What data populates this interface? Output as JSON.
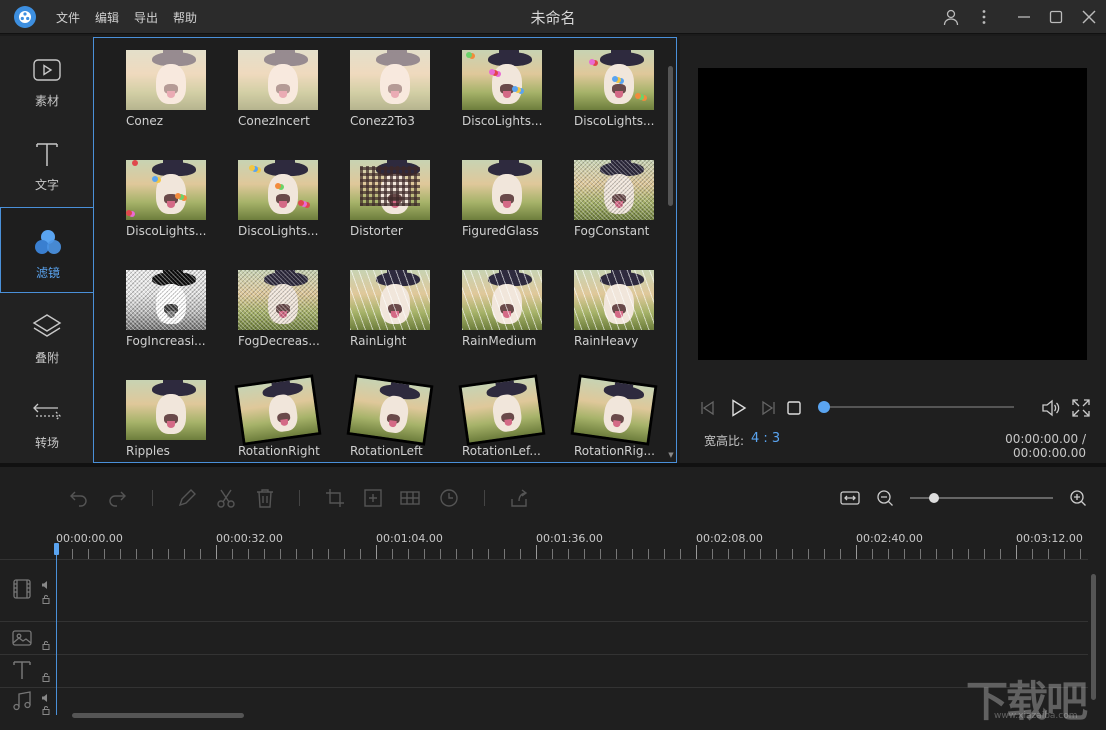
{
  "window": {
    "title": "未命名",
    "menu": [
      "文件",
      "编辑",
      "导出",
      "帮助"
    ],
    "icons": [
      "app-logo-icon",
      "user-icon",
      "more-icon",
      "minimize-icon",
      "maximize-icon",
      "close-icon"
    ]
  },
  "sidebar": {
    "items": [
      {
        "label": "素材",
        "icon": "media-icon",
        "active": false
      },
      {
        "label": "文字",
        "icon": "text-icon",
        "active": false
      },
      {
        "label": "滤镜",
        "icon": "filter-icon",
        "active": true
      },
      {
        "label": "叠附",
        "icon": "overlay-icon",
        "active": false
      },
      {
        "label": "转场",
        "icon": "transition-icon",
        "active": false
      }
    ]
  },
  "filters": [
    {
      "name": "Conez",
      "style": "faded"
    },
    {
      "name": "ConezIncert",
      "style": "faded"
    },
    {
      "name": "Conez2To3",
      "style": "faded"
    },
    {
      "name": "DiscoLights...",
      "style": "disco"
    },
    {
      "name": "DiscoLights...",
      "style": "disco"
    },
    {
      "name": "DiscoLights...",
      "style": "disco"
    },
    {
      "name": "DiscoLights...",
      "style": "disco"
    },
    {
      "name": "Distorter",
      "style": "pixel"
    },
    {
      "name": "FiguredGlass",
      "style": "plain"
    },
    {
      "name": "FogConstant",
      "style": "noise"
    },
    {
      "name": "FogIncreasi...",
      "style": "gray"
    },
    {
      "name": "FogDecreas...",
      "style": "noise"
    },
    {
      "name": "RainLight",
      "style": "rain"
    },
    {
      "name": "RainMedium",
      "style": "rain"
    },
    {
      "name": "RainHeavy",
      "style": "rain"
    },
    {
      "name": "Ripples",
      "style": "plain"
    },
    {
      "name": "RotationRight",
      "style": "rot"
    },
    {
      "name": "RotationLeft",
      "style": "rotl"
    },
    {
      "name": "RotationLef...",
      "style": "rot"
    },
    {
      "name": "RotationRig...",
      "style": "rotl"
    }
  ],
  "preview": {
    "aspect_label": "宽高比:",
    "aspect_value": "4 : 3",
    "timecode": "00:00:00.00 / 00:00:00.00",
    "progress": 0
  },
  "timeline": {
    "ruler": [
      "00:00:00.00",
      "00:00:32.00",
      "00:01:04.00",
      "00:01:36.00",
      "00:02:08.00",
      "00:02:40.00",
      "00:03:12.00"
    ],
    "zoom_level": 0.17,
    "tracks": [
      "video-track-icon",
      "image-track-icon",
      "text-track-icon",
      "music-track-icon"
    ]
  },
  "watermark": {
    "text": "下载吧",
    "sub": "www.xiazaiba.com"
  },
  "colors": {
    "accent": "#4a90d9",
    "accent_light": "#5aa4f0",
    "background": "#1f1f1f"
  }
}
